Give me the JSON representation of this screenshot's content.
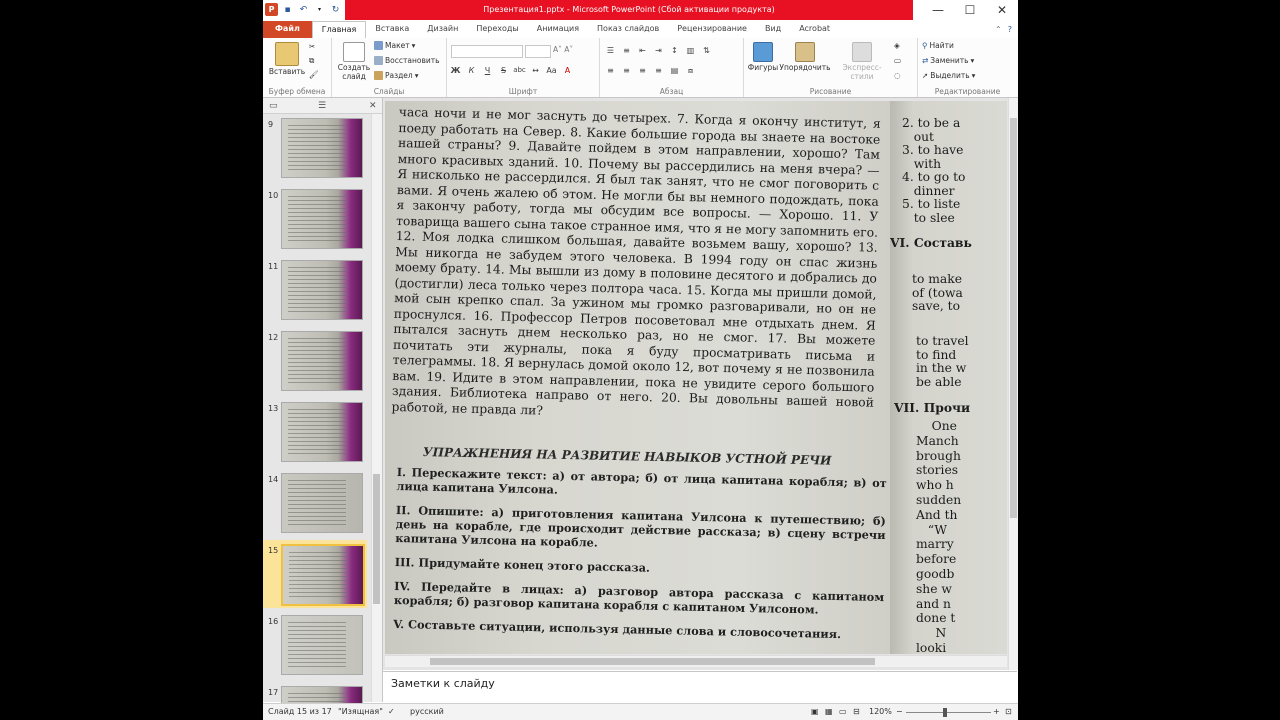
{
  "window": {
    "title": "Презентация1.pptx - Microsoft PowerPoint (Сбой активации продукта)",
    "minimize": "—",
    "maximize": "☐",
    "close": "✕"
  },
  "qat": {
    "app_icon": "P",
    "save_icon": "save-icon",
    "undo_icon": "undo-icon",
    "redo_icon": "redo-icon"
  },
  "tabs": [
    {
      "label": "Файл"
    },
    {
      "label": "Главная"
    },
    {
      "label": "Вставка"
    },
    {
      "label": "Дизайн"
    },
    {
      "label": "Переходы"
    },
    {
      "label": "Анимация"
    },
    {
      "label": "Показ слайдов"
    },
    {
      "label": "Рецензирование"
    },
    {
      "label": "Вид"
    },
    {
      "label": "Acrobat"
    }
  ],
  "ribbon": {
    "clipboard": {
      "paste": "Вставить",
      "label": "Буфер обмена"
    },
    "slides": {
      "new_slide": "Создать слайд",
      "layout": "Макет",
      "reset": "Восстановить",
      "section": "Раздел",
      "label": "Слайды"
    },
    "font": {
      "label": "Шрифт",
      "bold": "Ж",
      "italic": "К",
      "underline": "Ч",
      "strike": "S",
      "shadow": "abc"
    },
    "paragraph": {
      "label": "Абзац"
    },
    "drawing": {
      "shapes": "Фигуры",
      "arrange": "Упорядочить",
      "quick_styles": "Экспресс-стили",
      "label": "Рисование"
    },
    "editing": {
      "find": "Найти",
      "replace": "Заменить",
      "select": "Выделить",
      "label": "Редактирование"
    }
  },
  "slides_panel": {
    "items": [
      {
        "num": "9"
      },
      {
        "num": "10"
      },
      {
        "num": "11"
      },
      {
        "num": "12"
      },
      {
        "num": "13"
      },
      {
        "num": "14"
      },
      {
        "num": "15"
      },
      {
        "num": "16"
      },
      {
        "num": "17"
      }
    ],
    "selected": "15"
  },
  "slide": {
    "paragraph": "часа ночи и не мог заснуть до четырех. 7. Когда я окончу институт, я поеду работать на Север. 8. Какие большие города вы знаете на востоке нашей страны? 9. Давайте пойдем в этом направлении, хорошо? Там много красивых зданий. 10. Почему вы рассердились на меня вчера? — Я нисколько не рассердился. Я был так занят, что не смог поговорить с вами. Я очень жалею об этом. Не могли бы вы немного подождать, пока я закончу работу, тогда мы обсудим все вопросы. — Хорошо. 11. У товарища вашего сына такое странное имя, что я не могу запомнить его. 12. Моя лодка слишком большая, давайте возьмем вашу, хорошо? 13. Мы никогда не забудем этого человека. В 1994 году он спас жизнь моему брату. 14. Мы вышли из дому в половине десятого и добрались до (достигли) леса только через полтора часа. 15. Когда мы пришли домой, мой сын крепко спал. За ужином мы громко разговаривали, но он не проснулся. 16. Профессор Петров посоветовал мне отдыхать днем. Я пытался заснуть днем несколько раз, но не смог. 17. Вы можете почитать эти журналы, пока я буду просматривать письма и телеграммы. 18. Я вернулась домой около 12, вот почему я не позвонила вам. 19. Идите в этом направлении, пока не увидите серого большого здания. Библиотека направо от него. 20. Вы довольны вашей новой работой, не правда ли?",
    "section_title": "УПРАЖНЕНИЯ НА РАЗВИТИЕ НАВЫКОВ УСТНОЙ РЕЧИ",
    "exercises": [
      "I. Перескажите текст: а) от автора; б) от лица капитана корабля; в) от лица капитана Уилсона.",
      "II. Опишите: а) приготовления капитана Уилсона к путешествию; б) день на корабле, где происходит действие рассказа; в) сцену встречи капитана Уилсона на корабле.",
      "III. Придумайте конец этого рассказа.",
      "IV. Передайте в лицах: а) разговор автора рассказа с капитаном корабля; б) разговор капитана корабля с капитаном Уилсоном.",
      "V. Составьте ситуации, используя данные слова и словосочетания."
    ],
    "right_col": {
      "block1": "2. to be a\n   out\n3. to have\n   with\n4. to go to\n   dinner\n5. to liste\n   to slee",
      "block2": "VI. Составь",
      "block3": "to make\nof (towa\nsave, to",
      "block4": "to travel\nto find\nin the w\nbe able",
      "block5": "VII. Прочи",
      "block6": "    One\nManch\nbrough\nstories\nwho h\nsudden\nAnd th\n   “W\nmarry\nbefore\ngoodb\nshe w\nand n\ndone t\n     N\nlooki"
    }
  },
  "notes": {
    "placeholder": "Заметки к слайду"
  },
  "status": {
    "slide_info": "Слайд 15 из 17",
    "theme": "\"Изящная\"",
    "language": "русский",
    "zoom": "120%",
    "zoom_out": "−",
    "zoom_in": "+"
  }
}
